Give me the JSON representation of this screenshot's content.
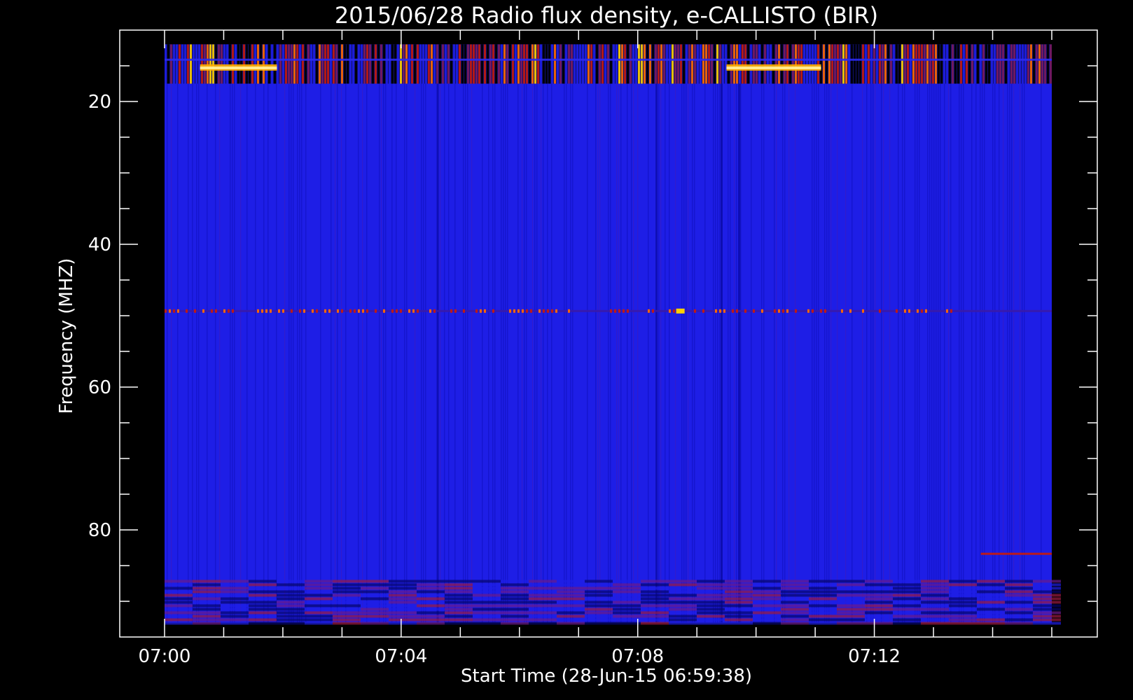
{
  "chart_data": {
    "type": "heatmap",
    "title": "2015/06/28  Radio flux density, e-CALLISTO (BIR)",
    "xlabel": "Start Time (28-Jun-15 06:59:38)",
    "ylabel": "Frequency (MHZ)",
    "x_ticks": [
      "07:00",
      "07:04",
      "07:08",
      "07:12"
    ],
    "x_tick_minutes": [
      0,
      4,
      8,
      12
    ],
    "x_data_range_minutes": [
      0,
      15
    ],
    "y_ticks": [
      20,
      40,
      60,
      80
    ],
    "y_range_mhz": [
      10,
      95
    ],
    "y_data_range_mhz": [
      12,
      93
    ],
    "y_inverted": true,
    "colormap": [
      "#000000",
      "#0a0a8c",
      "#1e1ee6",
      "#6a1a8a",
      "#c41a10",
      "#ff6a00",
      "#ffd000",
      "#ffffff"
    ],
    "background_color": "#1e1ee6",
    "features": [
      {
        "band_mhz": [
          12,
          17.5
        ],
        "intensity": "high",
        "description": "bright interference band"
      },
      {
        "band_mhz": [
          49,
          49.8
        ],
        "intensity": "medium",
        "description": "narrow dashed emission line"
      },
      {
        "band_mhz": [
          87,
          93
        ],
        "intensity": "medium",
        "description": "noisy lower band"
      },
      {
        "band_mhz": [
          83,
          83.5
        ],
        "x_minutes": [
          13.8,
          15
        ],
        "intensity": "medium",
        "description": "short horizontal line"
      }
    ]
  }
}
